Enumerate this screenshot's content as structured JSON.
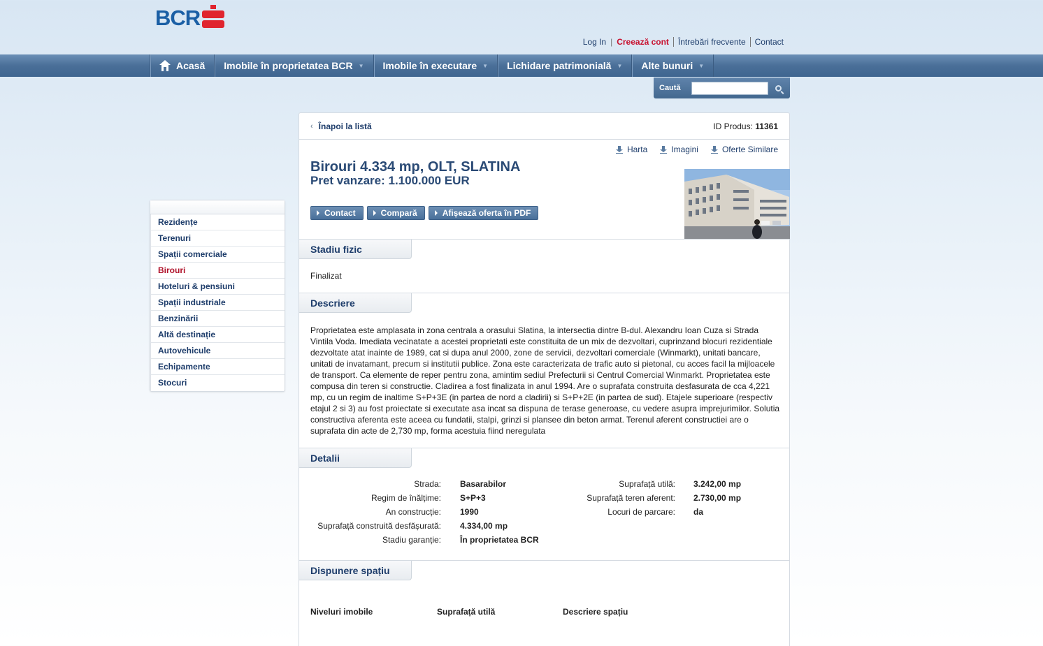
{
  "header": {
    "logo_text": "BCR",
    "links": {
      "login": "Log In",
      "separator": "|",
      "create_account": "Creează cont",
      "faq": "Întrebări frecvente",
      "contact": "Contact"
    }
  },
  "nav": {
    "items": [
      {
        "label": "Acasă"
      },
      {
        "label": "Imobile în proprietatea BCR"
      },
      {
        "label": "Imobile în executare"
      },
      {
        "label": "Lichidare patrimonială"
      },
      {
        "label": "Alte bunuri"
      }
    ]
  },
  "search": {
    "label": "Caută",
    "value": ""
  },
  "sidebar": {
    "items": [
      {
        "label": "Rezidențe"
      },
      {
        "label": "Terenuri"
      },
      {
        "label": "Spații comerciale"
      },
      {
        "label": "Birouri"
      },
      {
        "label": "Hoteluri & pensiuni"
      },
      {
        "label": "Spații industriale"
      },
      {
        "label": "Benzinării"
      },
      {
        "label": "Altă destinație"
      },
      {
        "label": "Autovehicule"
      },
      {
        "label": "Echipamente"
      },
      {
        "label": "Stocuri"
      }
    ],
    "active": "Birouri"
  },
  "product": {
    "back_label": "Înapoi la listă",
    "id_label": "ID Produs:",
    "id_value": "11361",
    "tools": {
      "map": "Harta",
      "images": "Imagini",
      "similar": "Oferte Similare"
    },
    "title": "Birouri 4.334 mp, OLT, SLATINA",
    "price": "Pret vanzare: 1.100.000 EUR",
    "actions": {
      "contact": "Contact",
      "compare": "Compară",
      "pdf": "Afișează oferta în PDF"
    }
  },
  "sections": {
    "stadiu_title": "Stadiu fizic",
    "stadiu_value": "Finalizat",
    "descriere_title": "Descriere",
    "descriere_text": "Proprietatea este amplasata in zona centrala a orasului Slatina, la intersectia dintre B-dul. Alexandru Ioan Cuza si Strada Vintila Voda. Imediata vecinatate a acestei proprietati este constituita de un mix de dezvoltari, cuprinzand blocuri rezidentiale dezvoltate atat inainte de 1989, cat si dupa anul 2000, zone de servicii, dezvoltari comerciale (Winmarkt), unitati bancare, unitati de invatamant, precum si institutii publice. Zona este caracterizata de trafic auto si pietonal, cu acces facil la mijloacele de transport. Ca elemente de reper pentru zona, amintim sediul Prefecturii si Centrul Comercial Winmarkt. Proprietatea este compusa din teren si constructie. Cladirea a fost finalizata in anul 1994. Are o suprafata construita desfasurata de cca 4,221 mp, cu un regim de inaltime S+P+3E (in partea de nord a cladirii) si S+P+2E (in partea de sud). Etajele superioare (respectiv etajul 2 si 3) au fost proiectate si executate asa incat sa dispuna de terase generoase, cu vedere asupra imprejurimilor. Solutia constructiva aferenta este aceea cu fundatii, stalpi, grinzi si plansee din beton armat. Terenul aferent constructiei are o suprafata din acte de 2,730 mp, forma acestuia fiind neregulata",
    "detalii_title": "Detalii",
    "details_left": [
      {
        "label": "Strada:",
        "value": "Basarabilor"
      },
      {
        "label": "Regim de înălțime:",
        "value": "S+P+3"
      },
      {
        "label": "An construcție:",
        "value": "1990"
      },
      {
        "label": "Suprafață construită desfășurată:",
        "value": "4.334,00 mp"
      },
      {
        "label": "Stadiu garanție:",
        "value": "În proprietatea BCR"
      }
    ],
    "details_right": [
      {
        "label": "Suprafață utilă:",
        "value": "3.242,00 mp"
      },
      {
        "label": "Suprafață teren aferent:",
        "value": "2.730,00 mp"
      },
      {
        "label": "Locuri de parcare:",
        "value": "da"
      }
    ],
    "dispunere_title": "Dispunere spațiu",
    "table_headers": [
      "Niveluri imobile",
      "Suprafață utilă",
      "Descriere spațiu"
    ]
  },
  "colors": {
    "accent": "#1e3d6b",
    "brand_red": "#e0242e",
    "active": "#b0122a",
    "nav": "#4a6f98"
  }
}
